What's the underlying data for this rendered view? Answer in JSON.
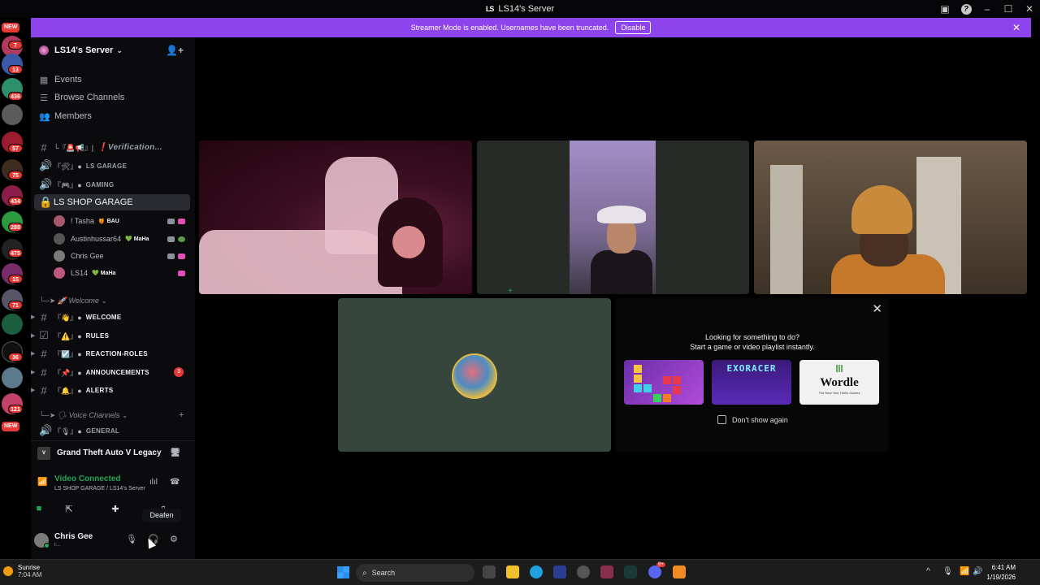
{
  "window": {
    "title": "LS14's Server"
  },
  "banner": {
    "text": "Streamer Mode is enabled. Usernames have been truncated.",
    "disable_label": "Disable"
  },
  "rail": {
    "new_label": "NEW",
    "badges": [
      "7",
      "13",
      "436",
      "57",
      "75",
      "434",
      "288",
      "475",
      "15",
      "71",
      "36",
      "121"
    ]
  },
  "server": {
    "name": "LS14's Server"
  },
  "nav": {
    "events": "Events",
    "browse": "Browse Channels",
    "members": "Members"
  },
  "channels": [
    {
      "emoji": "└『🚨📢』|",
      "name": "❗Verification..."
    },
    {
      "emoji": "『🛠』●",
      "name": "LS GARAGE"
    },
    {
      "emoji": "『🎮』●",
      "name": "GAMING"
    },
    {
      "emoji": "",
      "name": "LS SHOP GARAGE"
    }
  ],
  "voice_users": [
    {
      "name": "! Tasha",
      "tag": "BAU",
      "tag_emoji": "🍯"
    },
    {
      "name": "Austinhussar64",
      "tag": "MaHa",
      "tag_emoji": "💚"
    },
    {
      "name": "Chris Gee",
      "tag": "",
      "tag_emoji": ""
    },
    {
      "name": "LS14",
      "tag": "MaHa",
      "tag_emoji": "💚"
    }
  ],
  "categories": {
    "welcome": "└─➤ 🚀 Welcome ⌄",
    "voice": "└─➤ 🗣 Voice Channels ⌄"
  },
  "text_channels": [
    {
      "emoji": "『👋』●",
      "name": "WELCOME"
    },
    {
      "emoji": "『⚠️』●",
      "name": "RULES"
    },
    {
      "emoji": "『☑️』●",
      "name": "REACTION-ROLES"
    },
    {
      "emoji": "『📌』●",
      "name": "ANNOUNCEMENTS",
      "badge": "3"
    },
    {
      "emoji": "『🔔』●",
      "name": "ALERTS"
    },
    {
      "emoji": "『🎙』●",
      "name": "GENERAL"
    }
  ],
  "activity": {
    "game": "Grand Theft Auto V Legacy"
  },
  "voice_panel": {
    "status": "Video Connected",
    "location": "LS SHOP GARAGE / LS14's Server"
  },
  "tooltip": {
    "text": "Deafen"
  },
  "user": {
    "name": "Chris Gee",
    "sub": "i..."
  },
  "activities_panel": {
    "line1": "Looking for something to do?",
    "line2": "Start a game or video playlist instantly.",
    "games": [
      "",
      "EXORACER",
      "Wordle"
    ],
    "wordle_sub": "The New York Times Games",
    "dont_show": "Don't show again"
  },
  "taskbar": {
    "weather_title": "Sunrise",
    "weather_time": "7:04 AM",
    "search": "Search",
    "time": "6:41 AM",
    "date": "1/19/2026",
    "discord_badge": "9+"
  },
  "colors": {
    "banner": "#8e44ec",
    "connected": "#23a55a",
    "badge": "#e53935"
  }
}
